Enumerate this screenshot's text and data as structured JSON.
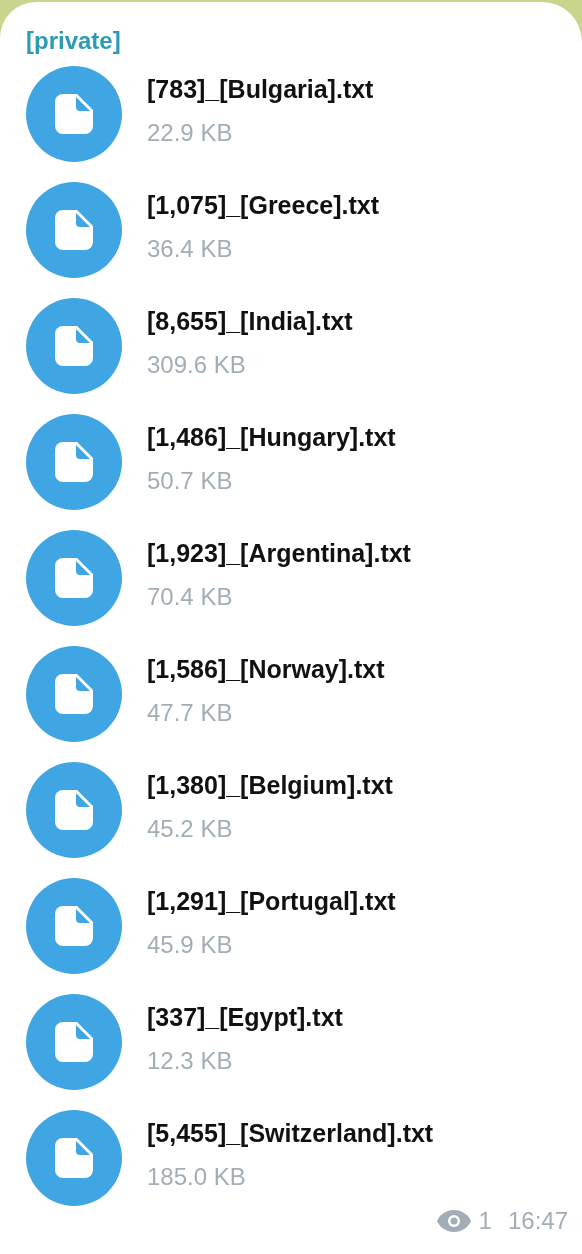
{
  "message": {
    "sender": "[private]",
    "files": [
      {
        "name": "[783]_[Bulgaria].txt",
        "size": "22.9 KB"
      },
      {
        "name": "[1,075]_[Greece].txt",
        "size": "36.4 KB"
      },
      {
        "name": "[8,655]_[India].txt",
        "size": "309.6 KB"
      },
      {
        "name": "[1,486]_[Hungary].txt",
        "size": "50.7 KB"
      },
      {
        "name": "[1,923]_[Argentina].txt",
        "size": "70.4 KB"
      },
      {
        "name": "[1,586]_[Norway].txt",
        "size": "47.7 KB"
      },
      {
        "name": "[1,380]_[Belgium].txt",
        "size": "45.2 KB"
      },
      {
        "name": "[1,291]_[Portugal].txt",
        "size": "45.9 KB"
      },
      {
        "name": "[337]_[Egypt].txt",
        "size": "12.3 KB"
      },
      {
        "name": "[5,455]_[Switzerland].txt",
        "size": "185.0 KB"
      }
    ],
    "views": "1",
    "time": "16:47"
  }
}
